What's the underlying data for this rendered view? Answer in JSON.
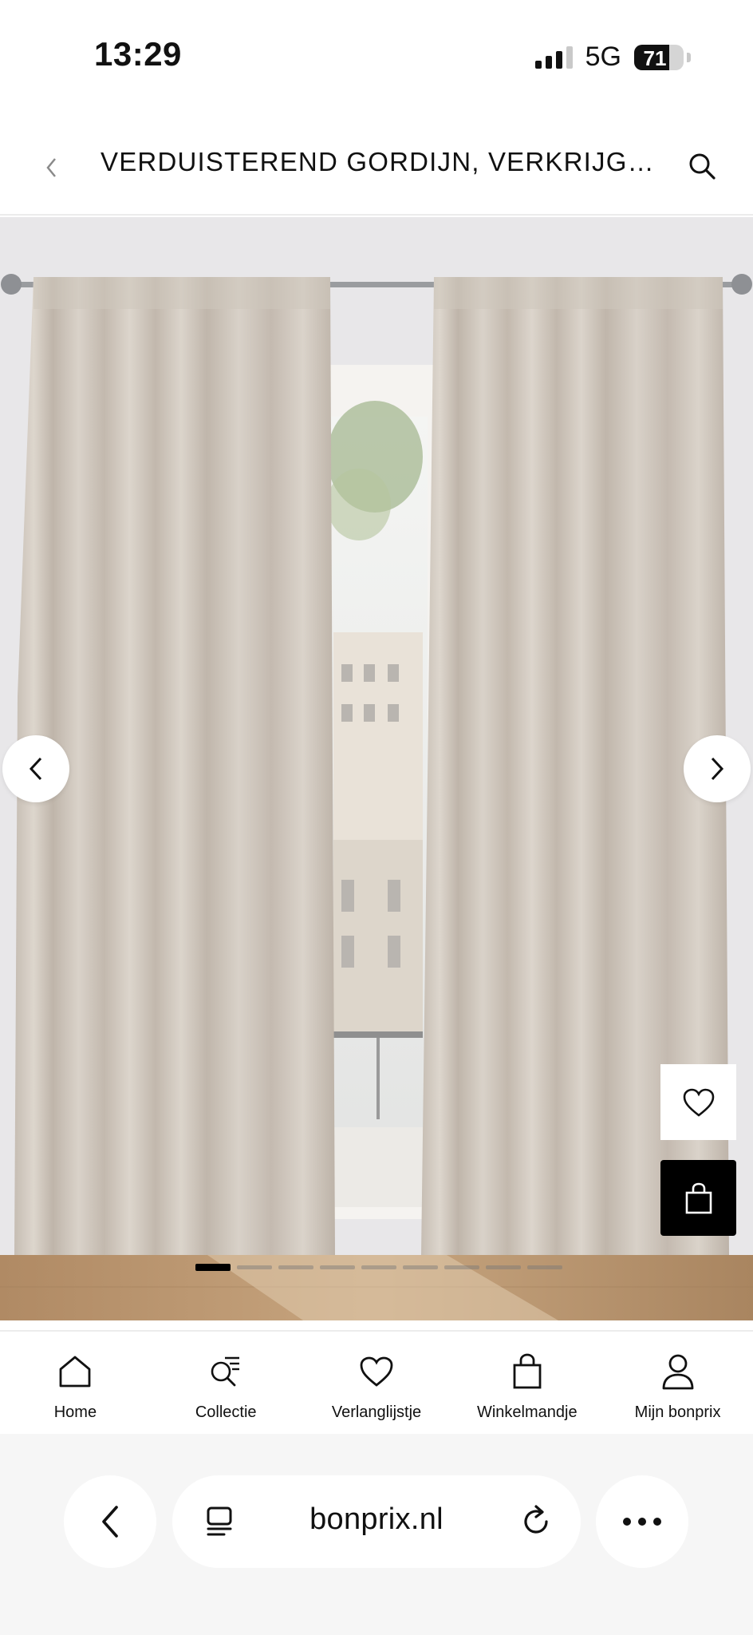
{
  "status_bar": {
    "time": "13:29",
    "network": "5G",
    "battery": "71",
    "battery_level": 0.71
  },
  "header": {
    "back_icon": "chevron-left-icon",
    "title": "VERDUISTEREND GORDIJN, VERKRIJGBA...",
    "search_icon": "search-icon"
  },
  "gallery": {
    "prev_icon": "chevron-left-icon",
    "next_icon": "chevron-right-icon",
    "wishlist_icon": "heart-icon",
    "cart_icon": "shopping-bag-icon",
    "slide_count": 9,
    "active_slide": 1
  },
  "bottom_nav": {
    "items": [
      {
        "label": "Home",
        "icon": "home-icon"
      },
      {
        "label": "Collectie",
        "icon": "collection-search-icon"
      },
      {
        "label": "Verlanglijstje",
        "icon": "heart-icon"
      },
      {
        "label": "Winkelmandje",
        "icon": "shopping-bag-icon"
      },
      {
        "label": "Mijn bonprix",
        "icon": "user-icon"
      }
    ]
  },
  "browser": {
    "url": "bonprix.nl",
    "back_icon": "chevron-left-icon",
    "tabs_icon": "tabs-icon",
    "reload_icon": "reload-icon",
    "more_icon": "more-icon"
  },
  "colors": {
    "curtain": "#cfc6bd",
    "floor": "#b8926a",
    "accent": "#000000"
  }
}
